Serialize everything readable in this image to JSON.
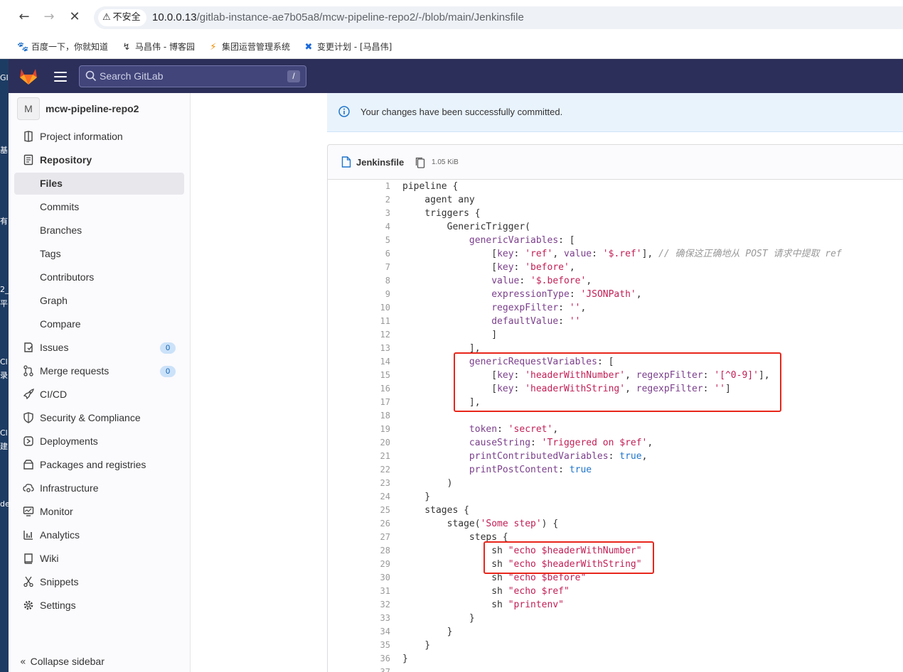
{
  "browser": {
    "back_glyph": "←",
    "forward_glyph": "→",
    "stop_glyph": "✕",
    "security_label": "不安全",
    "url_host": "10.0.0.13",
    "url_path": "/gitlab-instance-ae7b05a8/mcw-pipeline-repo2/-/blob/main/Jenkinsfile",
    "bookmarks": [
      {
        "label": "百度一下，你就知道",
        "icon": "paw-icon",
        "color": "#2932e1"
      },
      {
        "label": "马昌伟 - 博客园",
        "icon": "cnblogs-icon",
        "color": "#333333"
      },
      {
        "label": "集团运营管理系统",
        "icon": "fire-icon",
        "color": "#f08c00"
      },
      {
        "label": "变更计划 - [马昌伟]",
        "icon": "confluence-icon",
        "color": "#1868db"
      }
    ]
  },
  "desktop_strip": [
    "GI",
    "基",
    "有",
    "2_",
    "平",
    "Cl",
    "录",
    "Cl",
    "建",
    "de"
  ],
  "header": {
    "search_placeholder": "Search GitLab",
    "search_shortcut": "/",
    "brand_color": "#2b2f59"
  },
  "sidebar": {
    "project_initial": "M",
    "project_name": "mcw-pipeline-repo2",
    "items": [
      {
        "label": "Project information",
        "icon": "project-icon",
        "level": "top"
      },
      {
        "label": "Repository",
        "icon": "doc-icon",
        "level": "top",
        "bold": true
      },
      {
        "label": "Files",
        "level": "sub",
        "active": true
      },
      {
        "label": "Commits",
        "level": "sub"
      },
      {
        "label": "Branches",
        "level": "sub"
      },
      {
        "label": "Tags",
        "level": "sub"
      },
      {
        "label": "Contributors",
        "level": "sub"
      },
      {
        "label": "Graph",
        "level": "sub"
      },
      {
        "label": "Compare",
        "level": "sub"
      },
      {
        "label": "Issues",
        "icon": "issues-icon",
        "level": "top",
        "count": "0"
      },
      {
        "label": "Merge requests",
        "icon": "merge-request-icon",
        "level": "top",
        "count": "0"
      },
      {
        "label": "CI/CD",
        "icon": "rocket-icon",
        "level": "top"
      },
      {
        "label": "Security & Compliance",
        "icon": "shield-icon",
        "level": "top"
      },
      {
        "label": "Deployments",
        "icon": "deployments-icon",
        "level": "top"
      },
      {
        "label": "Packages and registries",
        "icon": "package-icon",
        "level": "top"
      },
      {
        "label": "Infrastructure",
        "icon": "cloud-gear-icon",
        "level": "top"
      },
      {
        "label": "Monitor",
        "icon": "monitor-icon",
        "level": "top"
      },
      {
        "label": "Analytics",
        "icon": "chart-icon",
        "level": "top"
      },
      {
        "label": "Wiki",
        "icon": "book-icon",
        "level": "top"
      },
      {
        "label": "Snippets",
        "icon": "scissors-icon",
        "level": "top"
      },
      {
        "label": "Settings",
        "icon": "gear-icon",
        "level": "top"
      }
    ],
    "collapse_label": "Collapse sidebar"
  },
  "alert": {
    "message": "Your changes have been successfully committed."
  },
  "file": {
    "name": "Jenkinsfile",
    "size": "1.05 KiB"
  },
  "code_lines": [
    [
      [
        "p",
        "pipeline {"
      ]
    ],
    [
      [
        "p",
        "    agent any"
      ]
    ],
    [
      [
        "p",
        "    triggers {"
      ]
    ],
    [
      [
        "p",
        "        GenericTrigger("
      ]
    ],
    [
      [
        "p",
        "            "
      ],
      [
        "k",
        "genericVariables"
      ],
      [
        "p",
        ": ["
      ]
    ],
    [
      [
        "p",
        "                ["
      ],
      [
        "k",
        "key"
      ],
      [
        "p",
        ": "
      ],
      [
        "s",
        "'ref'"
      ],
      [
        "p",
        ", "
      ],
      [
        "k",
        "value"
      ],
      [
        "p",
        ": "
      ],
      [
        "s",
        "'$.ref'"
      ],
      [
        "p",
        "], "
      ],
      [
        "c",
        "// 确保这正确地从 POST 请求中提取 ref"
      ]
    ],
    [
      [
        "p",
        "                ["
      ],
      [
        "k",
        "key"
      ],
      [
        "p",
        ": "
      ],
      [
        "s",
        "'before'"
      ],
      [
        "p",
        ","
      ]
    ],
    [
      [
        "p",
        "                "
      ],
      [
        "k",
        "value"
      ],
      [
        "p",
        ": "
      ],
      [
        "s",
        "'$.before'"
      ],
      [
        "p",
        ","
      ]
    ],
    [
      [
        "p",
        "                "
      ],
      [
        "k",
        "expressionType"
      ],
      [
        "p",
        ": "
      ],
      [
        "s",
        "'JSONPath'"
      ],
      [
        "p",
        ","
      ]
    ],
    [
      [
        "p",
        "                "
      ],
      [
        "k",
        "regexpFilter"
      ],
      [
        "p",
        ": "
      ],
      [
        "s",
        "''"
      ],
      [
        "p",
        ","
      ]
    ],
    [
      [
        "p",
        "                "
      ],
      [
        "k",
        "defaultValue"
      ],
      [
        "p",
        ": "
      ],
      [
        "s",
        "''"
      ]
    ],
    [
      [
        "p",
        "                ]"
      ]
    ],
    [
      [
        "p",
        "            ],"
      ]
    ],
    [
      [
        "p",
        "            "
      ],
      [
        "k",
        "genericRequestVariables"
      ],
      [
        "p",
        ": ["
      ]
    ],
    [
      [
        "p",
        "                ["
      ],
      [
        "k",
        "key"
      ],
      [
        "p",
        ": "
      ],
      [
        "s",
        "'headerWithNumber'"
      ],
      [
        "p",
        ", "
      ],
      [
        "k",
        "regexpFilter"
      ],
      [
        "p",
        ": "
      ],
      [
        "s",
        "'[^0-9]'"
      ],
      [
        "p",
        "],"
      ]
    ],
    [
      [
        "p",
        "                ["
      ],
      [
        "k",
        "key"
      ],
      [
        "p",
        ": "
      ],
      [
        "s",
        "'headerWithString'"
      ],
      [
        "p",
        ", "
      ],
      [
        "k",
        "regexpFilter"
      ],
      [
        "p",
        ": "
      ],
      [
        "s",
        "''"
      ],
      [
        "p",
        "]"
      ]
    ],
    [
      [
        "p",
        "            ],"
      ]
    ],
    [
      [
        "p",
        ""
      ]
    ],
    [
      [
        "p",
        "            "
      ],
      [
        "k",
        "token"
      ],
      [
        "p",
        ": "
      ],
      [
        "s",
        "'secret'"
      ],
      [
        "p",
        ","
      ]
    ],
    [
      [
        "p",
        "            "
      ],
      [
        "k",
        "causeString"
      ],
      [
        "p",
        ": "
      ],
      [
        "s",
        "'Triggered on $ref'"
      ],
      [
        "p",
        ","
      ]
    ],
    [
      [
        "p",
        "            "
      ],
      [
        "k",
        "printContributedVariables"
      ],
      [
        "p",
        ": "
      ],
      [
        "b",
        "true"
      ],
      [
        "p",
        ","
      ]
    ],
    [
      [
        "p",
        "            "
      ],
      [
        "k",
        "printPostContent"
      ],
      [
        "p",
        ": "
      ],
      [
        "b",
        "true"
      ]
    ],
    [
      [
        "p",
        "        )"
      ]
    ],
    [
      [
        "p",
        "    }"
      ]
    ],
    [
      [
        "p",
        "    stages {"
      ]
    ],
    [
      [
        "p",
        "        stage("
      ],
      [
        "s",
        "'Some step'"
      ],
      [
        "p",
        ") {"
      ]
    ],
    [
      [
        "p",
        "            steps {"
      ]
    ],
    [
      [
        "p",
        "                sh "
      ],
      [
        "s",
        "\"echo $headerWithNumber\""
      ]
    ],
    [
      [
        "p",
        "                sh "
      ],
      [
        "s",
        "\"echo $headerWithString\""
      ]
    ],
    [
      [
        "p",
        "                sh "
      ],
      [
        "s",
        "\"echo $before\""
      ]
    ],
    [
      [
        "p",
        "                sh "
      ],
      [
        "s",
        "\"echo $ref\""
      ]
    ],
    [
      [
        "p",
        "                sh "
      ],
      [
        "s",
        "\"printenv\""
      ]
    ],
    [
      [
        "p",
        "            }"
      ]
    ],
    [
      [
        "p",
        "        }"
      ]
    ],
    [
      [
        "p",
        "    }"
      ]
    ],
    [
      [
        "p",
        "}"
      ]
    ],
    [
      [
        "p",
        ""
      ]
    ]
  ],
  "highlights": [
    {
      "from_line": 14,
      "to_line": 17,
      "note": "red-outline"
    },
    {
      "from_line": 28,
      "to_line": 29,
      "note": "red-outline"
    }
  ]
}
